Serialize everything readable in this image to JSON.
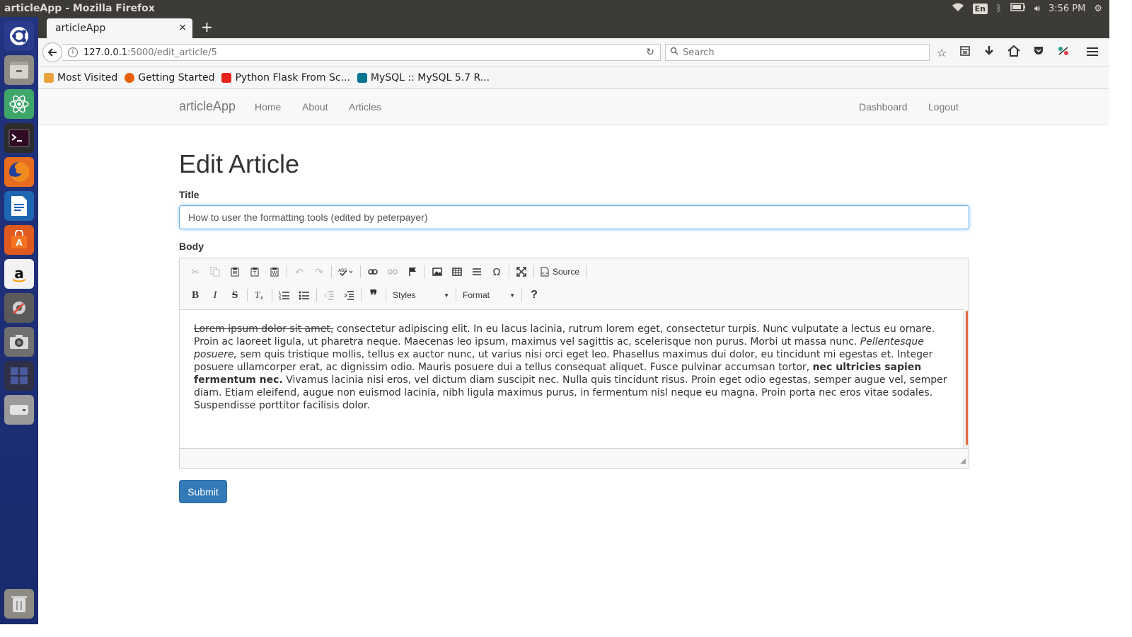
{
  "os": {
    "window_title": "articleApp - Mozilla Firefox",
    "lang": "En",
    "clock": "3:56 PM"
  },
  "launcher": {
    "items": [
      "ubuntu-dash-icon",
      "files-icon",
      "atom-icon",
      "terminal-icon",
      "firefox-icon",
      "writer-icon",
      "software-center-icon",
      "amazon-icon",
      "settings-icon",
      "camera-icon",
      "workspace-icon",
      "drive-icon",
      "trash-icon"
    ]
  },
  "browser": {
    "tab_title": "articleApp",
    "tab_close": "×",
    "new_tab": "+",
    "url_host": "127.0.0.1",
    "url_path": ":5000/edit_article/5",
    "search_placeholder": "Search",
    "bookmarks": [
      {
        "label": "Most Visited",
        "color": "#e8a33d"
      },
      {
        "label": "Getting Started",
        "color": "#e66000"
      },
      {
        "label": "Python Flask From Sc...",
        "color": "#e62117"
      },
      {
        "label": "MySQL :: MySQL 5.7 R...",
        "color": "#00758f"
      }
    ]
  },
  "site": {
    "brand": "articleApp",
    "nav_left": [
      "Home",
      "About",
      "Articles"
    ],
    "nav_right": [
      "Dashboard",
      "Logout"
    ]
  },
  "form": {
    "heading": "Edit Article",
    "title_label": "Title",
    "title_value": "How to user the formatting tools (edited by peterpayer)",
    "body_label": "Body",
    "toolbar": {
      "source_label": "Source",
      "styles_label": "Styles",
      "format_label": "Format",
      "help_label": "?"
    },
    "body": {
      "strike": "Lorem ipsum dolor sit amet,",
      "text1": " consectetur adipiscing elit. In eu lacus lacinia, rutrum lorem eget, consectetur turpis. Nunc vulputate a lectus eu ornare. Proin ac laoreet ligula, ut pharetra neque. Maecenas leo ipsum, maximus vel sagittis ac, scelerisque non purus. Morbi ut massa nunc. ",
      "italic": "Pellentesque posuere,",
      "text2": " sem quis tristique mollis, tellus ex auctor nunc, ut varius nisi orci eget leo. Phasellus maximus dui dolor, eu tincidunt mi egestas et. Integer posuere ullamcorper erat, ac dignissim odio. Mauris posuere dui a tellus consequat aliquet. Fusce pulvinar accumsan tortor, ",
      "bold": "nec ultricies sapien fermentum nec.",
      "text3": " Vivamus lacinia nisi eros, vel dictum diam suscipit nec. Nulla quis tincidunt risus. Proin eget odio egestas, semper augue vel, semper diam. Etiam eleifend, augue non euismod lacinia, nibh ligula maximus purus, in fermentum nisl neque eu magna. Proin porta nec eros vitae sodales. Suspendisse porttitor facilisis dolor."
    },
    "submit_label": "Submit"
  },
  "colors": {
    "launcher_bg": "#1d2e7a",
    "primary_button": "#337ab7",
    "focus_border": "#66afe9"
  }
}
